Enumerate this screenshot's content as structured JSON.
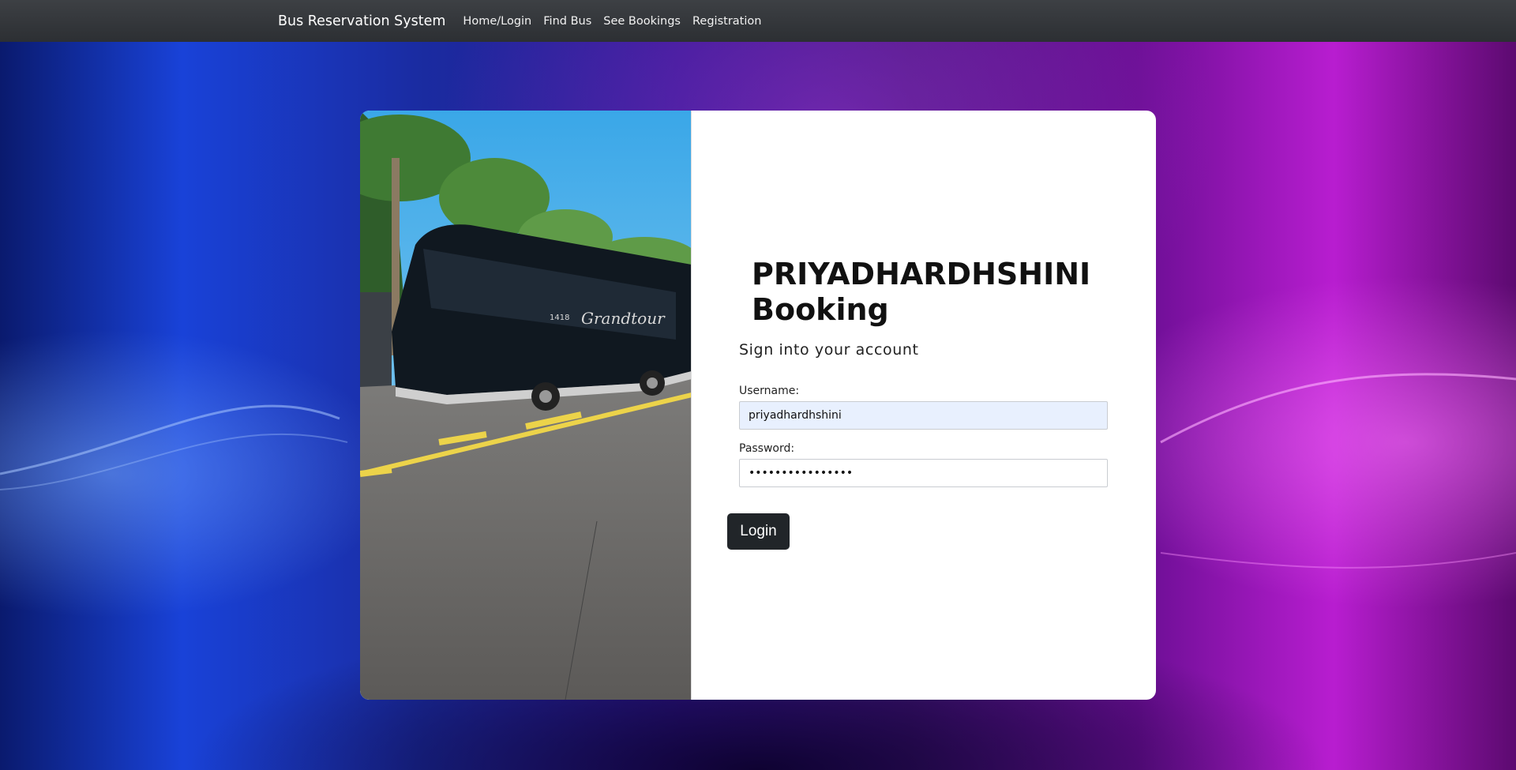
{
  "navbar": {
    "brand": "Bus Reservation System",
    "links": [
      "Home/Login",
      "Find Bus",
      "See Bookings",
      "Registration"
    ]
  },
  "card": {
    "title_line1": "PRIYADHARDHSHINI",
    "title_line2": "Booking",
    "subtitle": "Sign into your account",
    "username": {
      "label": "Username:",
      "value": "priyadhardhshini"
    },
    "password": {
      "label": "Password:",
      "value": "••••••••••••••••"
    },
    "login_label": "Login"
  },
  "photo": {
    "bus_text": "Grandtour",
    "bus_number": "1418"
  },
  "colors": {
    "navbar": "#2c2f33",
    "button": "#212529",
    "autofill": "#e8f0fe"
  }
}
